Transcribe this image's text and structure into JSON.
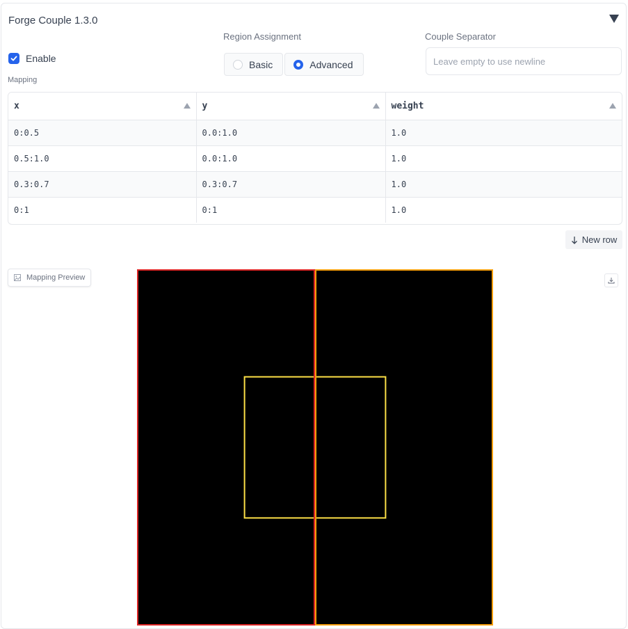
{
  "header": {
    "title": "Forge Couple 1.3.0"
  },
  "enable": {
    "label": "Enable",
    "checked": true
  },
  "region_assignment": {
    "label": "Region Assignment",
    "options": [
      {
        "label": "Basic",
        "selected": false
      },
      {
        "label": "Advanced",
        "selected": true
      }
    ]
  },
  "couple_separator": {
    "label": "Couple Separator",
    "value": "",
    "placeholder": "Leave empty to use newline"
  },
  "mapping": {
    "label": "Mapping",
    "columns": [
      "x",
      "y",
      "weight"
    ],
    "rows": [
      [
        "0:0.5",
        "0.0:1.0",
        "1.0"
      ],
      [
        "0.5:1.0",
        "0.0:1.0",
        "1.0"
      ],
      [
        "0.3:0.7",
        "0.3:0.7",
        "1.0"
      ],
      [
        "0:1",
        "0:1",
        "1.0"
      ]
    ],
    "new_row_label": "New row"
  },
  "preview": {
    "label": "Mapping Preview",
    "background": "#000000",
    "region_colors": [
      "#dc2626",
      "#f59e0b",
      "#fde047",
      "#16a34a"
    ]
  },
  "colors": {
    "accent": "#2563eb"
  }
}
